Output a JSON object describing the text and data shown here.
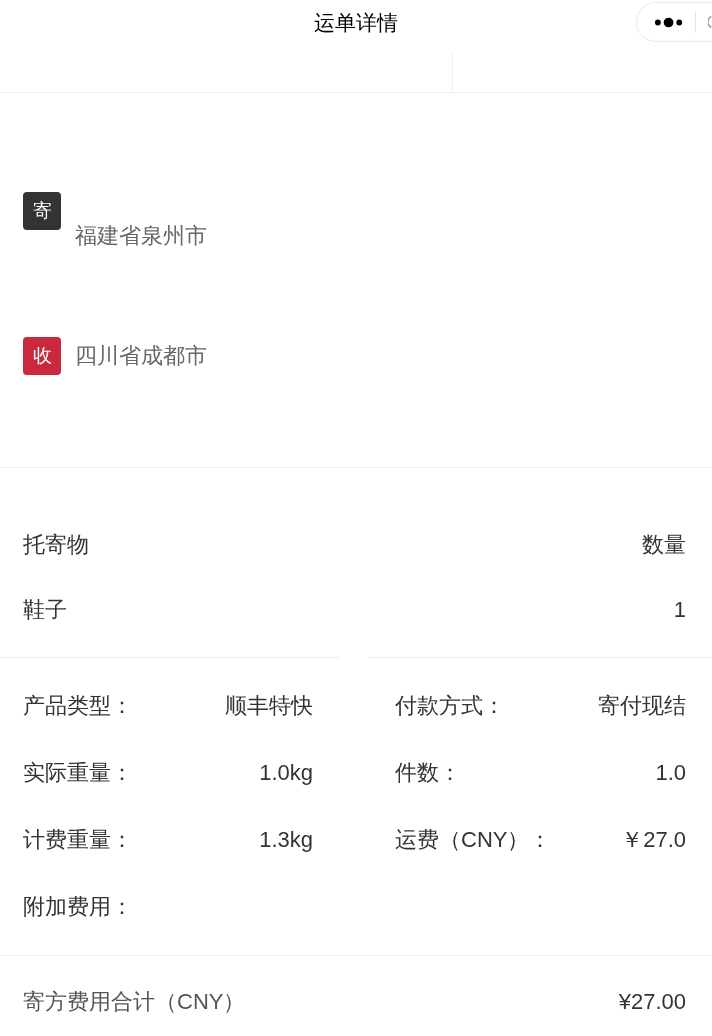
{
  "header": {
    "title": "运单详情"
  },
  "addresses": [
    {
      "kind": "sender",
      "badge": "寄",
      "region": "福建省泉州市"
    },
    {
      "kind": "receiver",
      "badge": "收",
      "region": "四川省成都市"
    }
  ],
  "goods": {
    "columns": [
      "托寄物",
      "数量"
    ],
    "rows": [
      [
        "鞋子",
        "1"
      ]
    ]
  },
  "details": [
    {
      "label": "产品类型：",
      "value": "顺丰特快"
    },
    {
      "label": "付款方式：",
      "value": "寄付现结"
    },
    {
      "label": "实际重量：",
      "value": "1.0kg"
    },
    {
      "label": "件数：",
      "value": "1.0"
    },
    {
      "label": "计费重量：",
      "value": "1.3kg"
    },
    {
      "label": "运费（CNY）：",
      "value": "￥27.0"
    },
    {
      "label": "附加费用："
    }
  ],
  "total": {
    "label": "寄方费用合计（CNY）",
    "value": "¥27.00"
  }
}
